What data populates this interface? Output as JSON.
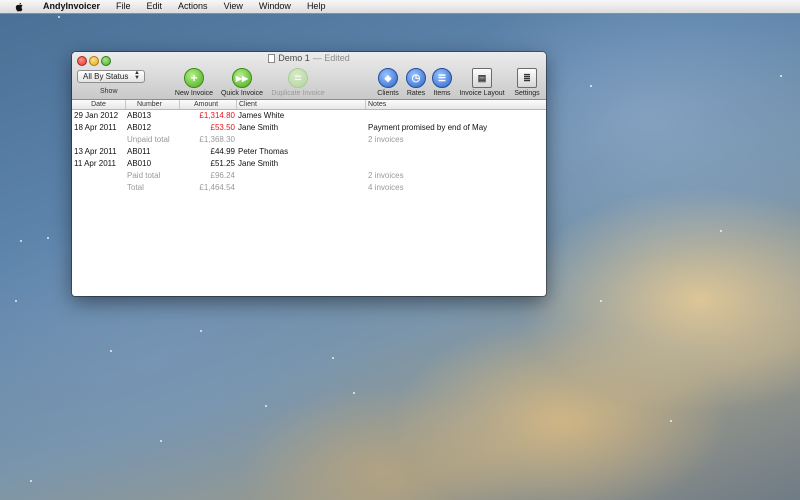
{
  "menubar": {
    "app_name": "AndyInvoicer",
    "items": [
      "File",
      "Edit",
      "Actions",
      "View",
      "Window",
      "Help"
    ]
  },
  "window": {
    "title": "Demo 1",
    "edited_suffix": "— Edited"
  },
  "toolbar": {
    "show_popup_value": "All By Status",
    "show_label": "Show",
    "new_invoice": "New Invoice",
    "quick_invoice": "Quick Invoice",
    "duplicate_invoice": "Duplicate Invoice",
    "clients": "Clients",
    "rates": "Rates",
    "items": "Items",
    "invoice_layout": "Invoice Layout",
    "settings": "Settings"
  },
  "table": {
    "columns": [
      "Date",
      "Number",
      "Amount",
      "Client",
      "Notes"
    ],
    "rows": [
      {
        "date": "29 Jan 2012",
        "number": "AB013",
        "amount": "£1,314.80",
        "client": "James White",
        "notes": ""
      },
      {
        "date": "18 Apr 2011",
        "number": "AB012",
        "amount": "£53.50",
        "client": "Jane Smith",
        "notes": "Payment promised by end of May"
      },
      {
        "date": "",
        "number": "Unpaid total",
        "amount": "£1,368.30",
        "client": "",
        "notes": "2 invoices"
      },
      {
        "date": "13 Apr 2011",
        "number": "AB011",
        "amount": "£44.99",
        "client": "Peter Thomas",
        "notes": ""
      },
      {
        "date": "11 Apr 2011",
        "number": "AB010",
        "amount": "£51.25",
        "client": "Jane Smith",
        "notes": ""
      },
      {
        "date": "",
        "number": "Paid total",
        "amount": "£96.24",
        "client": "",
        "notes": "2 invoices"
      },
      {
        "date": "",
        "number": "Total",
        "amount": "£1,464.54",
        "client": "",
        "notes": "4 invoices"
      }
    ]
  },
  "colors": {
    "overdue_amount": "#e0181c",
    "summary_text": "#9a9a9a"
  }
}
